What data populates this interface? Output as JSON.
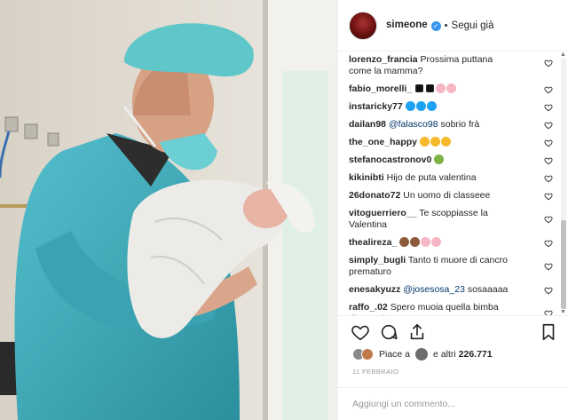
{
  "header": {
    "username": "simeone",
    "verified_glyph": "✓",
    "separator": "•",
    "follow_label": "Segui già"
  },
  "comments": [
    {
      "user": "lorenzo_francia",
      "text": "Prossima puttana",
      "text2": "come la mamma?"
    },
    {
      "user": "fabio_morelli_",
      "emoji": [
        "black-heart",
        "black-heart",
        "pig-face",
        "pig-face"
      ]
    },
    {
      "user": "instaricky77",
      "emoji": [
        "blue-circle",
        "blue-circle",
        "blue-circle"
      ]
    },
    {
      "user": "dailan98",
      "mention": "@falasco98",
      "text": "sobrio frà"
    },
    {
      "user": "the_one_happy",
      "emoji": [
        "clap",
        "clap",
        "clap"
      ]
    },
    {
      "user": "stefanocastronov0",
      "emoji": [
        "nauseated-face"
      ]
    },
    {
      "user": "kikinibti",
      "text": "Hijo de puta valentina"
    },
    {
      "user": "26donato72",
      "text": "Un uomo di classeee"
    },
    {
      "user": "vitoguerriero__",
      "text": "Te scoppiasse la",
      "text2": "Valentina"
    },
    {
      "user": "thealireza_",
      "emoji": [
        "poop",
        "poop",
        "pig-face",
        "pig-face"
      ]
    },
    {
      "user": "simply_bugli",
      "text": "Tanto ti muore di cancro",
      "text2": "prematuro"
    },
    {
      "user": "enesakyuzz",
      "mention": "@josesosa_23",
      "text": "sosaaaaa"
    },
    {
      "user": "raffo_.02",
      "text": "Spero muoia quella bimba",
      "text2": "dimmerda"
    }
  ],
  "actions": {
    "like_icon": "heart-icon",
    "comment_icon": "comment-icon",
    "share_icon": "share-icon",
    "save_icon": "bookmark-icon"
  },
  "likes": {
    "prefix": "Piace a",
    "and_others": "e altri",
    "count": "226.771"
  },
  "date": "11 FEBBRAIO",
  "add_comment": {
    "placeholder": "Aggiungi un commento..."
  },
  "colors": {
    "verified": "#3897f0",
    "mention": "#003569",
    "scrubs": "#3aa8b5"
  }
}
